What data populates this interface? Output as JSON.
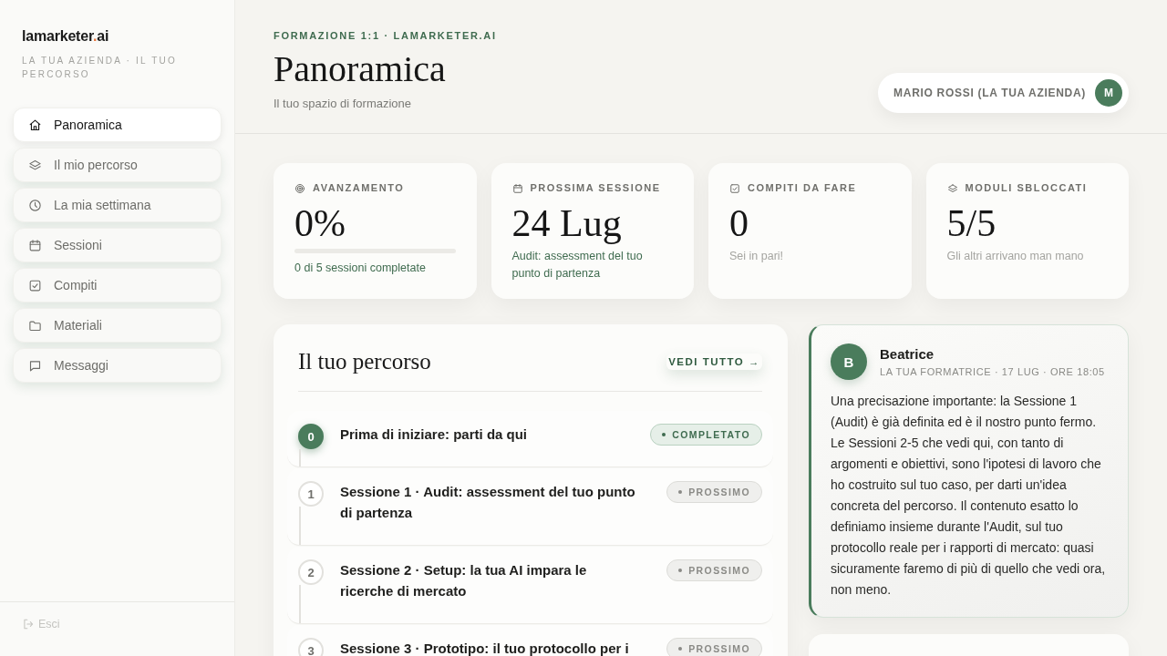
{
  "sidebar": {
    "brand": {
      "name": "lamarketer",
      "dot": ".",
      "suffix": "ai"
    },
    "tagline": "LA TUA AZIENDA · IL TUO PERCORSO",
    "nav": [
      {
        "label": "Panoramica",
        "selected": true
      },
      {
        "label": "Il mio percorso",
        "selected": false
      },
      {
        "label": "La mia settimana",
        "selected": false
      },
      {
        "label": "Sessioni",
        "selected": false
      },
      {
        "label": "Compiti",
        "selected": false
      },
      {
        "label": "Materiali",
        "selected": false
      },
      {
        "label": "Messaggi",
        "selected": false
      }
    ],
    "logout": "Esci"
  },
  "header": {
    "eyebrow": "FORMAZIONE 1:1 · LAMARKETER.AI",
    "title": "Panoramica",
    "subtitle": "Il tuo spazio di formazione",
    "user": {
      "name": "MARIO ROSSI (LA TUA AZIENDA)",
      "initial": "M"
    }
  },
  "stats": [
    {
      "label": "AVANZAMENTO",
      "value": "0%",
      "level": 0,
      "note": "0 di 5 sessioni completate",
      "accent": true
    },
    {
      "label": "PROSSIMA SESSIONE",
      "value": "24 Lug",
      "note": "Audit: assessment del tuo punto di partenza",
      "accent": true
    },
    {
      "label": "COMPITI DA FARE",
      "value": "0",
      "note": "Sei in pari!",
      "accent": false
    },
    {
      "label": "MODULI SBLOCCATI",
      "value": "5/5",
      "note": "Gli altri arrivano man mano",
      "accent": false
    }
  ],
  "path": {
    "title": "Il tuo percorso",
    "link": "VEDI TUTTO →",
    "steps": [
      {
        "number": "0",
        "title": "Prima di iniziare: parti da qui",
        "status": "COMPLETATO",
        "completed": true
      },
      {
        "number": "1",
        "title": "Sessione 1 · Audit: assessment del tuo punto di partenza",
        "status": "PROSSIMO",
        "completed": false
      },
      {
        "number": "2",
        "title": "Sessione 2 · Setup: la tua AI impara le ricerche di mercato",
        "status": "PROSSIMO",
        "completed": false
      },
      {
        "number": "3",
        "title": "Sessione 3 · Prototipo: il tuo protocollo per i",
        "status": "PROSSIMO",
        "completed": false
      }
    ]
  },
  "message": {
    "initial": "B",
    "author": "Beatrice",
    "meta": "LA TUA FORMATRICE · 17 LUG · ORE 18:05",
    "body": "Una precisazione importante: la Sessione 1 (Audit) è già definita ed è il nostro punto fermo. Le Sessioni 2-5 che vedi qui, con tanto di argomenti e obiettivi, sono l'ipotesi di lavoro che ho costruito sul tuo caso, per darti un'idea concreta del percorso. Il contenuto esatto lo definiamo insieme durante l'Audit, sul tuo protocollo reale per i rapporti di mercato: quasi sicuramente faremo di più di quello che vedi ora, non meno."
  }
}
